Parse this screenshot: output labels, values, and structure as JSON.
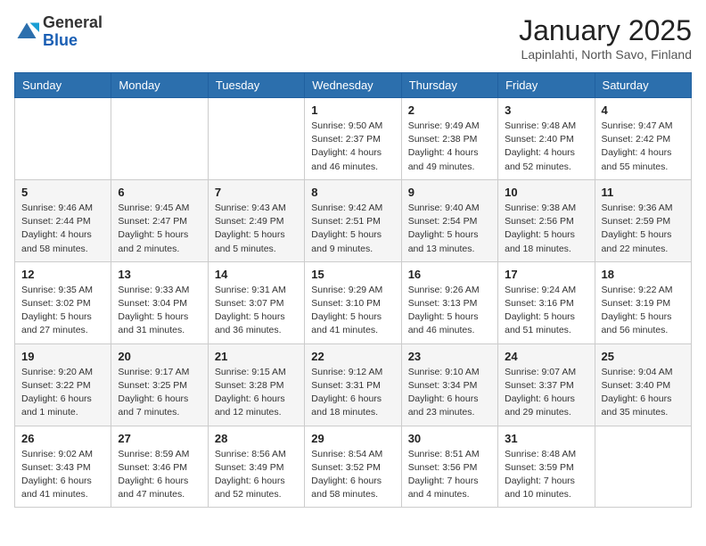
{
  "header": {
    "logo_general": "General",
    "logo_blue": "Blue",
    "month_title": "January 2025",
    "subtitle": "Lapinlahti, North Savo, Finland"
  },
  "weekdays": [
    "Sunday",
    "Monday",
    "Tuesday",
    "Wednesday",
    "Thursday",
    "Friday",
    "Saturday"
  ],
  "weeks": [
    [
      {
        "day": "",
        "info": ""
      },
      {
        "day": "",
        "info": ""
      },
      {
        "day": "",
        "info": ""
      },
      {
        "day": "1",
        "info": "Sunrise: 9:50 AM\nSunset: 2:37 PM\nDaylight: 4 hours\nand 46 minutes."
      },
      {
        "day": "2",
        "info": "Sunrise: 9:49 AM\nSunset: 2:38 PM\nDaylight: 4 hours\nand 49 minutes."
      },
      {
        "day": "3",
        "info": "Sunrise: 9:48 AM\nSunset: 2:40 PM\nDaylight: 4 hours\nand 52 minutes."
      },
      {
        "day": "4",
        "info": "Sunrise: 9:47 AM\nSunset: 2:42 PM\nDaylight: 4 hours\nand 55 minutes."
      }
    ],
    [
      {
        "day": "5",
        "info": "Sunrise: 9:46 AM\nSunset: 2:44 PM\nDaylight: 4 hours\nand 58 minutes."
      },
      {
        "day": "6",
        "info": "Sunrise: 9:45 AM\nSunset: 2:47 PM\nDaylight: 5 hours\nand 2 minutes."
      },
      {
        "day": "7",
        "info": "Sunrise: 9:43 AM\nSunset: 2:49 PM\nDaylight: 5 hours\nand 5 minutes."
      },
      {
        "day": "8",
        "info": "Sunrise: 9:42 AM\nSunset: 2:51 PM\nDaylight: 5 hours\nand 9 minutes."
      },
      {
        "day": "9",
        "info": "Sunrise: 9:40 AM\nSunset: 2:54 PM\nDaylight: 5 hours\nand 13 minutes."
      },
      {
        "day": "10",
        "info": "Sunrise: 9:38 AM\nSunset: 2:56 PM\nDaylight: 5 hours\nand 18 minutes."
      },
      {
        "day": "11",
        "info": "Sunrise: 9:36 AM\nSunset: 2:59 PM\nDaylight: 5 hours\nand 22 minutes."
      }
    ],
    [
      {
        "day": "12",
        "info": "Sunrise: 9:35 AM\nSunset: 3:02 PM\nDaylight: 5 hours\nand 27 minutes."
      },
      {
        "day": "13",
        "info": "Sunrise: 9:33 AM\nSunset: 3:04 PM\nDaylight: 5 hours\nand 31 minutes."
      },
      {
        "day": "14",
        "info": "Sunrise: 9:31 AM\nSunset: 3:07 PM\nDaylight: 5 hours\nand 36 minutes."
      },
      {
        "day": "15",
        "info": "Sunrise: 9:29 AM\nSunset: 3:10 PM\nDaylight: 5 hours\nand 41 minutes."
      },
      {
        "day": "16",
        "info": "Sunrise: 9:26 AM\nSunset: 3:13 PM\nDaylight: 5 hours\nand 46 minutes."
      },
      {
        "day": "17",
        "info": "Sunrise: 9:24 AM\nSunset: 3:16 PM\nDaylight: 5 hours\nand 51 minutes."
      },
      {
        "day": "18",
        "info": "Sunrise: 9:22 AM\nSunset: 3:19 PM\nDaylight: 5 hours\nand 56 minutes."
      }
    ],
    [
      {
        "day": "19",
        "info": "Sunrise: 9:20 AM\nSunset: 3:22 PM\nDaylight: 6 hours\nand 1 minute."
      },
      {
        "day": "20",
        "info": "Sunrise: 9:17 AM\nSunset: 3:25 PM\nDaylight: 6 hours\nand 7 minutes."
      },
      {
        "day": "21",
        "info": "Sunrise: 9:15 AM\nSunset: 3:28 PM\nDaylight: 6 hours\nand 12 minutes."
      },
      {
        "day": "22",
        "info": "Sunrise: 9:12 AM\nSunset: 3:31 PM\nDaylight: 6 hours\nand 18 minutes."
      },
      {
        "day": "23",
        "info": "Sunrise: 9:10 AM\nSunset: 3:34 PM\nDaylight: 6 hours\nand 23 minutes."
      },
      {
        "day": "24",
        "info": "Sunrise: 9:07 AM\nSunset: 3:37 PM\nDaylight: 6 hours\nand 29 minutes."
      },
      {
        "day": "25",
        "info": "Sunrise: 9:04 AM\nSunset: 3:40 PM\nDaylight: 6 hours\nand 35 minutes."
      }
    ],
    [
      {
        "day": "26",
        "info": "Sunrise: 9:02 AM\nSunset: 3:43 PM\nDaylight: 6 hours\nand 41 minutes."
      },
      {
        "day": "27",
        "info": "Sunrise: 8:59 AM\nSunset: 3:46 PM\nDaylight: 6 hours\nand 47 minutes."
      },
      {
        "day": "28",
        "info": "Sunrise: 8:56 AM\nSunset: 3:49 PM\nDaylight: 6 hours\nand 52 minutes."
      },
      {
        "day": "29",
        "info": "Sunrise: 8:54 AM\nSunset: 3:52 PM\nDaylight: 6 hours\nand 58 minutes."
      },
      {
        "day": "30",
        "info": "Sunrise: 8:51 AM\nSunset: 3:56 PM\nDaylight: 7 hours\nand 4 minutes."
      },
      {
        "day": "31",
        "info": "Sunrise: 8:48 AM\nSunset: 3:59 PM\nDaylight: 7 hours\nand 10 minutes."
      },
      {
        "day": "",
        "info": ""
      }
    ]
  ]
}
